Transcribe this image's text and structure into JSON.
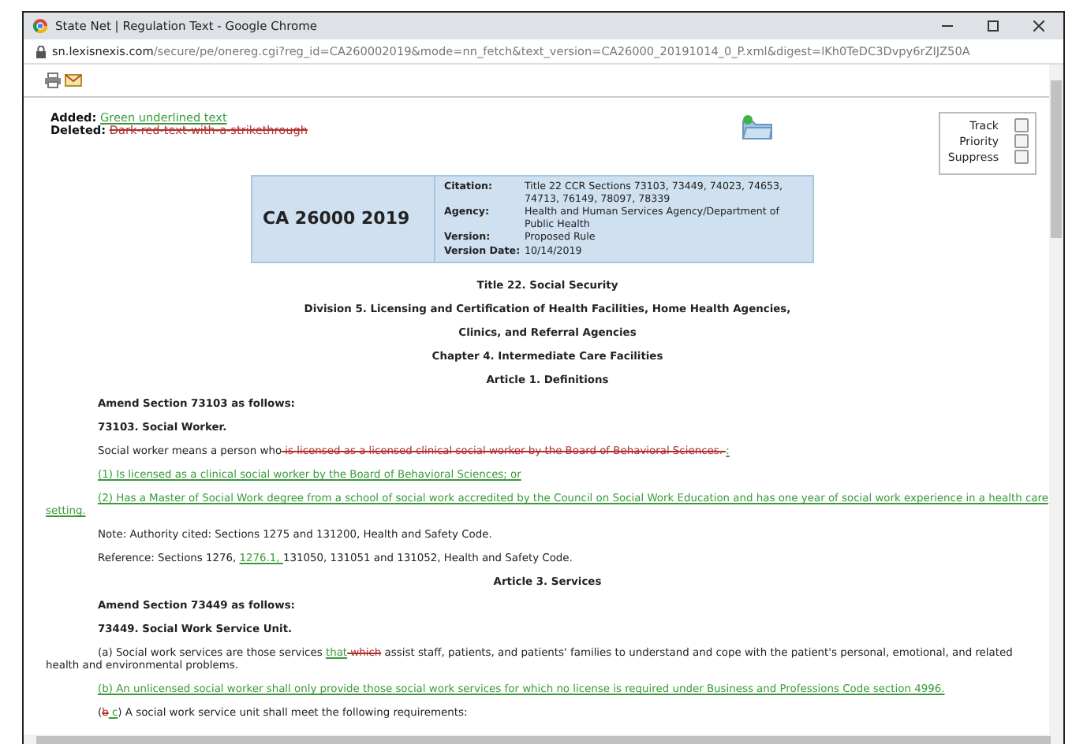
{
  "window": {
    "title": "State Net | Regulation Text - Google Chrome"
  },
  "address_bar": {
    "domain": "sn.lexisnexis.com",
    "path": "/secure/pe/onereg.cgi?reg_id=CA260002019&mode=nn_fetch&text_version=CA26000_20191014_0_P.xml&digest=lKh0TeDC3Dvpy6rZIJZ50A"
  },
  "legend": [
    {
      "label": "Added:",
      "sample": "Green underlined text",
      "kind": "added"
    },
    {
      "label": "Deleted:",
      "sample": "Dark-red-text-with-a-strikethrough",
      "kind": "deleted"
    }
  ],
  "options": [
    {
      "label": "Track",
      "checked": false
    },
    {
      "label": "Priority",
      "checked": false
    },
    {
      "label": "Suppress",
      "checked": false
    }
  ],
  "header": {
    "code": "CA 26000 2019",
    "fields": [
      {
        "label": "Citation:",
        "value": "Title 22 CCR Sections 73103, 73449, 74023, 74653, 74713, 76149, 78097, 78339"
      },
      {
        "label": "Agency:",
        "value": "Health and Human Services Agency/Department of Public Health"
      },
      {
        "label": "Version:",
        "value": "Proposed Rule"
      },
      {
        "label": "Version Date:",
        "value": "10/14/2019"
      }
    ]
  },
  "document": [
    {
      "kind": "heading",
      "text": "Title 22. Social Security"
    },
    {
      "kind": "heading",
      "text": "Division 5. Licensing and Certification of Health Facilities, Home Health Agencies,"
    },
    {
      "kind": "heading",
      "text": "Clinics, and Referral Agencies"
    },
    {
      "kind": "heading",
      "text": "Chapter 4. Intermediate Care Facilities"
    },
    {
      "kind": "heading",
      "text": "Article 1. Definitions"
    },
    {
      "kind": "subheading",
      "text": "Amend Section 73103 as follows:"
    },
    {
      "kind": "subheading",
      "text": "73103. Social Worker."
    },
    {
      "kind": "paragraph",
      "segments": [
        {
          "kind": "plain",
          "text": "Social worker means a person who"
        },
        {
          "kind": "deleted",
          "text": " is licensed as a licensed clinical social worker by the Board of Behavioral Sciences. "
        },
        {
          "kind": "added",
          "text": ":"
        }
      ]
    },
    {
      "kind": "paragraph",
      "segments": [
        {
          "kind": "added",
          "text": "(1) Is licensed as a clinical social worker by the Board of Behavioral Sciences; or"
        }
      ]
    },
    {
      "kind": "paragraph",
      "segments": [
        {
          "kind": "added",
          "text": "(2) Has a Master of Social Work degree from a school of social work accredited by the Council on Social Work Education and has one year of social work experience in a health care setting."
        }
      ]
    },
    {
      "kind": "paragraph",
      "segments": [
        {
          "kind": "plain",
          "text": "Note: Authority cited: Sections 1275 and 131200, Health and Safety Code."
        }
      ]
    },
    {
      "kind": "paragraph",
      "segments": [
        {
          "kind": "plain",
          "text": "Reference: Sections 1276, "
        },
        {
          "kind": "added",
          "text": "1276.1, "
        },
        {
          "kind": "plain",
          "text": "131050, 131051 and 131052, Health and Safety Code."
        }
      ]
    },
    {
      "kind": "heading",
      "text": "Article 3. Services"
    },
    {
      "kind": "subheading",
      "text": "Amend Section 73449 as follows:"
    },
    {
      "kind": "subheading",
      "text": "73449. Social Work Service Unit."
    },
    {
      "kind": "paragraph",
      "segments": [
        {
          "kind": "plain",
          "text": "(a) Social work services are those services "
        },
        {
          "kind": "added",
          "text": "that"
        },
        {
          "kind": "deleted",
          "text": " which"
        },
        {
          "kind": "plain",
          "text": " assist staff, patients, and patients' families to understand and cope with the patient's personal, emotional, and related health and environmental problems."
        }
      ]
    },
    {
      "kind": "paragraph",
      "segments": [
        {
          "kind": "added",
          "text": "(b) An unlicensed social worker shall only provide those social work services for which no license is required under Business and Professions Code section 4996."
        }
      ]
    },
    {
      "kind": "paragraph",
      "segments": [
        {
          "kind": "plain",
          "text": "("
        },
        {
          "kind": "deleted",
          "text": "b"
        },
        {
          "kind": "added",
          "text": " c"
        },
        {
          "kind": "plain",
          "text": ") A social work service unit shall meet the following requirements:"
        }
      ]
    }
  ]
}
